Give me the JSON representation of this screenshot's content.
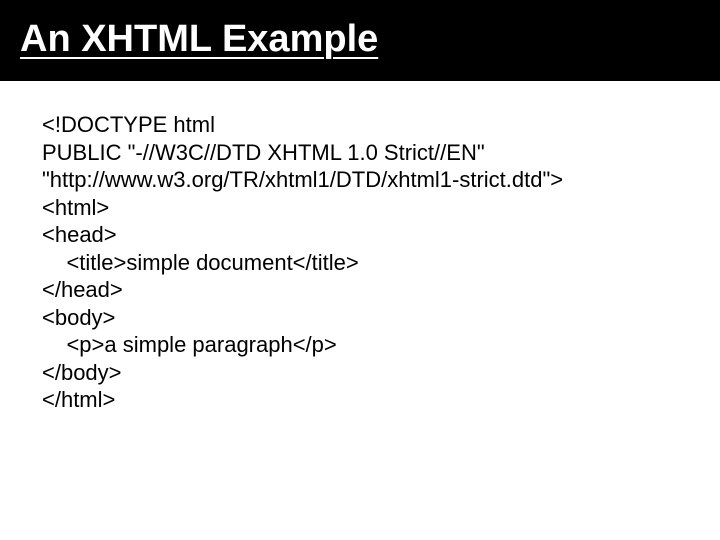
{
  "header": {
    "title": "An XHTML Example"
  },
  "code": {
    "lines": [
      "<!DOCTYPE html",
      "PUBLIC \"-//W3C//DTD XHTML 1.0 Strict//EN\"",
      "\"http://www.w3.org/TR/xhtml1/DTD/xhtml1-strict.dtd\">",
      "<html>",
      "<head>",
      "    <title>simple document</title>",
      "</head>",
      "<body>",
      "    <p>a simple paragraph</p>",
      "</body>",
      "</html>"
    ]
  }
}
